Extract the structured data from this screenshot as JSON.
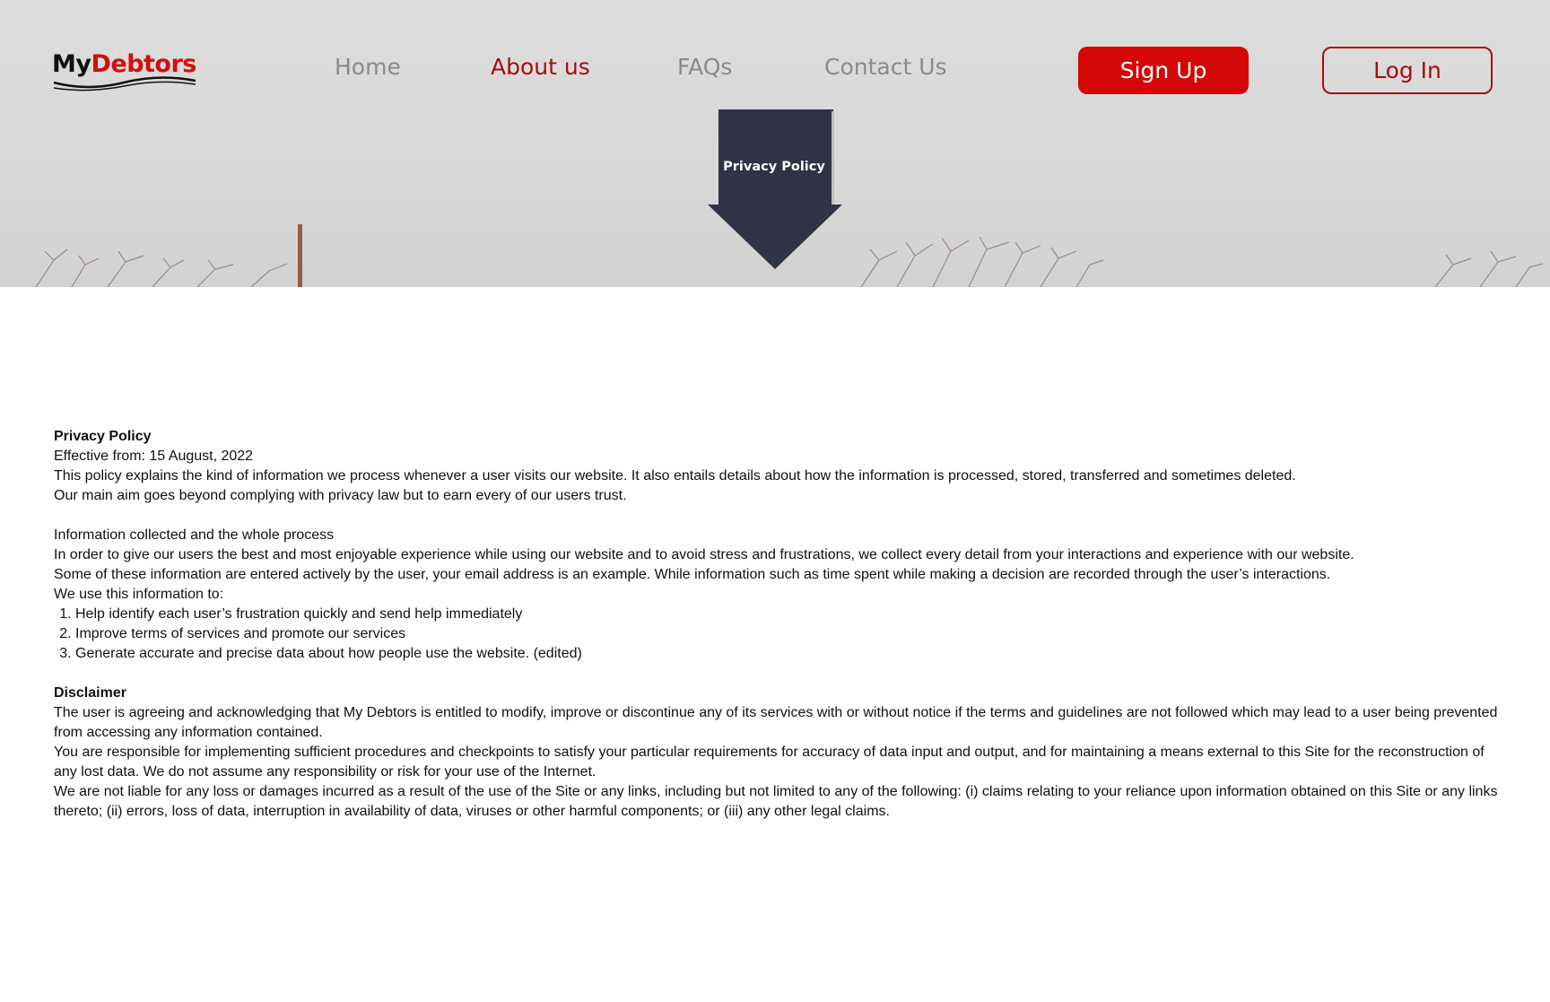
{
  "brand": {
    "logo_part1": "My",
    "logo_part2": "Debtors",
    "accent_color": "#d10f0f"
  },
  "nav": {
    "items": [
      {
        "label": "Home",
        "active": false
      },
      {
        "label": "About us",
        "active": true
      },
      {
        "label": "FAQs",
        "active": false
      },
      {
        "label": "Contact Us",
        "active": false
      }
    ],
    "signup_label": "Sign Up",
    "login_label": "Log In"
  },
  "banner": {
    "label": "Privacy Policy",
    "color": "#2f3345"
  },
  "policy": {
    "title": "Privacy Policy",
    "effective": "Effective from:  15 August, 2022",
    "intro_1": "This policy explains the kind of information we process whenever a user visits our website. It also entails details about how the information is processed, stored, transferred and sometimes deleted.",
    "intro_2": "Our main aim goes beyond complying with privacy law but to earn every of our users trust.",
    "info_heading": "Information collected and the whole process",
    "info_1": "In order to give our users the best and most enjoyable experience while using our website and to avoid stress and frustrations, we collect every detail from your interactions and experience with our website.",
    "info_2": "Some of these information are entered actively by the user, your email address is an example. While information such as time spent while making a decision are recorded through the user’s interactions.",
    "use_heading": "We use this information to:",
    "uses": [
      "Help identify each user’s frustration quickly and send help immediately",
      " Improve terms of services and promote our services",
      "Generate accurate and precise data about how people use the website. (edited)"
    ],
    "disclaimer_heading": "Disclaimer",
    "disclaimer_1": "The user is agreeing and acknowledging that My Debtors is entitled to modify, improve or discontinue any of its services with or without notice if the terms and guidelines are not followed which may lead to a user being prevented from accessing any information contained.",
    "disclaimer_2": "You are responsible for implementing sufficient procedures and checkpoints to satisfy your particular requirements for accuracy of data input and output, and for maintaining a means external to this Site for the reconstruction of any lost data. We do not assume any responsibility or risk for your use of the Internet.",
    "disclaimer_3": "We are not liable for any loss or damages incurred as a result of the use of the Site or any links, including but not limited to any of the following: (i) claims relating to your reliance upon information obtained on this Site or any links thereto; (ii) errors, loss of data, interruption in availability of data, viruses or other harmful components; or (iii) any other legal claims."
  }
}
